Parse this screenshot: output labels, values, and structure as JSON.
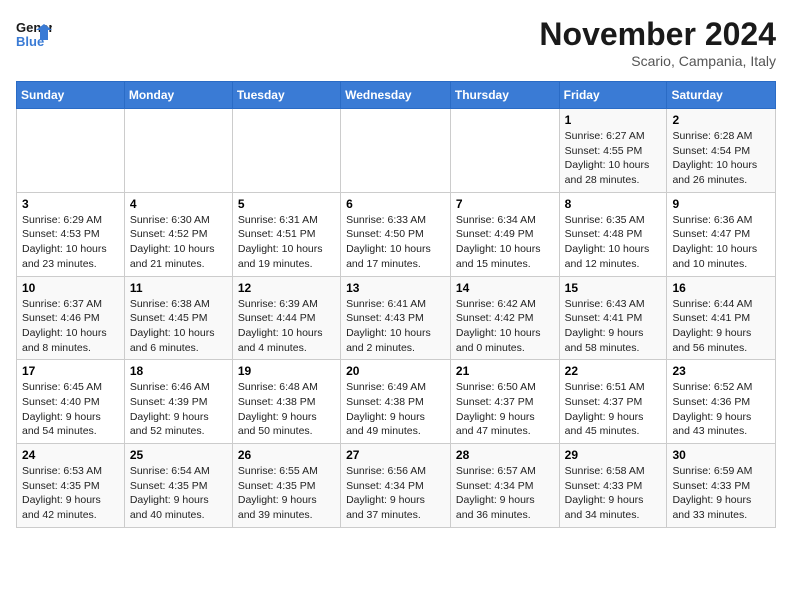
{
  "header": {
    "logo_general": "General",
    "logo_blue": "Blue",
    "month_title": "November 2024",
    "location": "Scario, Campania, Italy"
  },
  "days_of_week": [
    "Sunday",
    "Monday",
    "Tuesday",
    "Wednesday",
    "Thursday",
    "Friday",
    "Saturday"
  ],
  "weeks": [
    [
      {
        "day": "",
        "info": ""
      },
      {
        "day": "",
        "info": ""
      },
      {
        "day": "",
        "info": ""
      },
      {
        "day": "",
        "info": ""
      },
      {
        "day": "",
        "info": ""
      },
      {
        "day": "1",
        "info": "Sunrise: 6:27 AM\nSunset: 4:55 PM\nDaylight: 10 hours and 28 minutes."
      },
      {
        "day": "2",
        "info": "Sunrise: 6:28 AM\nSunset: 4:54 PM\nDaylight: 10 hours and 26 minutes."
      }
    ],
    [
      {
        "day": "3",
        "info": "Sunrise: 6:29 AM\nSunset: 4:53 PM\nDaylight: 10 hours and 23 minutes."
      },
      {
        "day": "4",
        "info": "Sunrise: 6:30 AM\nSunset: 4:52 PM\nDaylight: 10 hours and 21 minutes."
      },
      {
        "day": "5",
        "info": "Sunrise: 6:31 AM\nSunset: 4:51 PM\nDaylight: 10 hours and 19 minutes."
      },
      {
        "day": "6",
        "info": "Sunrise: 6:33 AM\nSunset: 4:50 PM\nDaylight: 10 hours and 17 minutes."
      },
      {
        "day": "7",
        "info": "Sunrise: 6:34 AM\nSunset: 4:49 PM\nDaylight: 10 hours and 15 minutes."
      },
      {
        "day": "8",
        "info": "Sunrise: 6:35 AM\nSunset: 4:48 PM\nDaylight: 10 hours and 12 minutes."
      },
      {
        "day": "9",
        "info": "Sunrise: 6:36 AM\nSunset: 4:47 PM\nDaylight: 10 hours and 10 minutes."
      }
    ],
    [
      {
        "day": "10",
        "info": "Sunrise: 6:37 AM\nSunset: 4:46 PM\nDaylight: 10 hours and 8 minutes."
      },
      {
        "day": "11",
        "info": "Sunrise: 6:38 AM\nSunset: 4:45 PM\nDaylight: 10 hours and 6 minutes."
      },
      {
        "day": "12",
        "info": "Sunrise: 6:39 AM\nSunset: 4:44 PM\nDaylight: 10 hours and 4 minutes."
      },
      {
        "day": "13",
        "info": "Sunrise: 6:41 AM\nSunset: 4:43 PM\nDaylight: 10 hours and 2 minutes."
      },
      {
        "day": "14",
        "info": "Sunrise: 6:42 AM\nSunset: 4:42 PM\nDaylight: 10 hours and 0 minutes."
      },
      {
        "day": "15",
        "info": "Sunrise: 6:43 AM\nSunset: 4:41 PM\nDaylight: 9 hours and 58 minutes."
      },
      {
        "day": "16",
        "info": "Sunrise: 6:44 AM\nSunset: 4:41 PM\nDaylight: 9 hours and 56 minutes."
      }
    ],
    [
      {
        "day": "17",
        "info": "Sunrise: 6:45 AM\nSunset: 4:40 PM\nDaylight: 9 hours and 54 minutes."
      },
      {
        "day": "18",
        "info": "Sunrise: 6:46 AM\nSunset: 4:39 PM\nDaylight: 9 hours and 52 minutes."
      },
      {
        "day": "19",
        "info": "Sunrise: 6:48 AM\nSunset: 4:38 PM\nDaylight: 9 hours and 50 minutes."
      },
      {
        "day": "20",
        "info": "Sunrise: 6:49 AM\nSunset: 4:38 PM\nDaylight: 9 hours and 49 minutes."
      },
      {
        "day": "21",
        "info": "Sunrise: 6:50 AM\nSunset: 4:37 PM\nDaylight: 9 hours and 47 minutes."
      },
      {
        "day": "22",
        "info": "Sunrise: 6:51 AM\nSunset: 4:37 PM\nDaylight: 9 hours and 45 minutes."
      },
      {
        "day": "23",
        "info": "Sunrise: 6:52 AM\nSunset: 4:36 PM\nDaylight: 9 hours and 43 minutes."
      }
    ],
    [
      {
        "day": "24",
        "info": "Sunrise: 6:53 AM\nSunset: 4:35 PM\nDaylight: 9 hours and 42 minutes."
      },
      {
        "day": "25",
        "info": "Sunrise: 6:54 AM\nSunset: 4:35 PM\nDaylight: 9 hours and 40 minutes."
      },
      {
        "day": "26",
        "info": "Sunrise: 6:55 AM\nSunset: 4:35 PM\nDaylight: 9 hours and 39 minutes."
      },
      {
        "day": "27",
        "info": "Sunrise: 6:56 AM\nSunset: 4:34 PM\nDaylight: 9 hours and 37 minutes."
      },
      {
        "day": "28",
        "info": "Sunrise: 6:57 AM\nSunset: 4:34 PM\nDaylight: 9 hours and 36 minutes."
      },
      {
        "day": "29",
        "info": "Sunrise: 6:58 AM\nSunset: 4:33 PM\nDaylight: 9 hours and 34 minutes."
      },
      {
        "day": "30",
        "info": "Sunrise: 6:59 AM\nSunset: 4:33 PM\nDaylight: 9 hours and 33 minutes."
      }
    ]
  ]
}
